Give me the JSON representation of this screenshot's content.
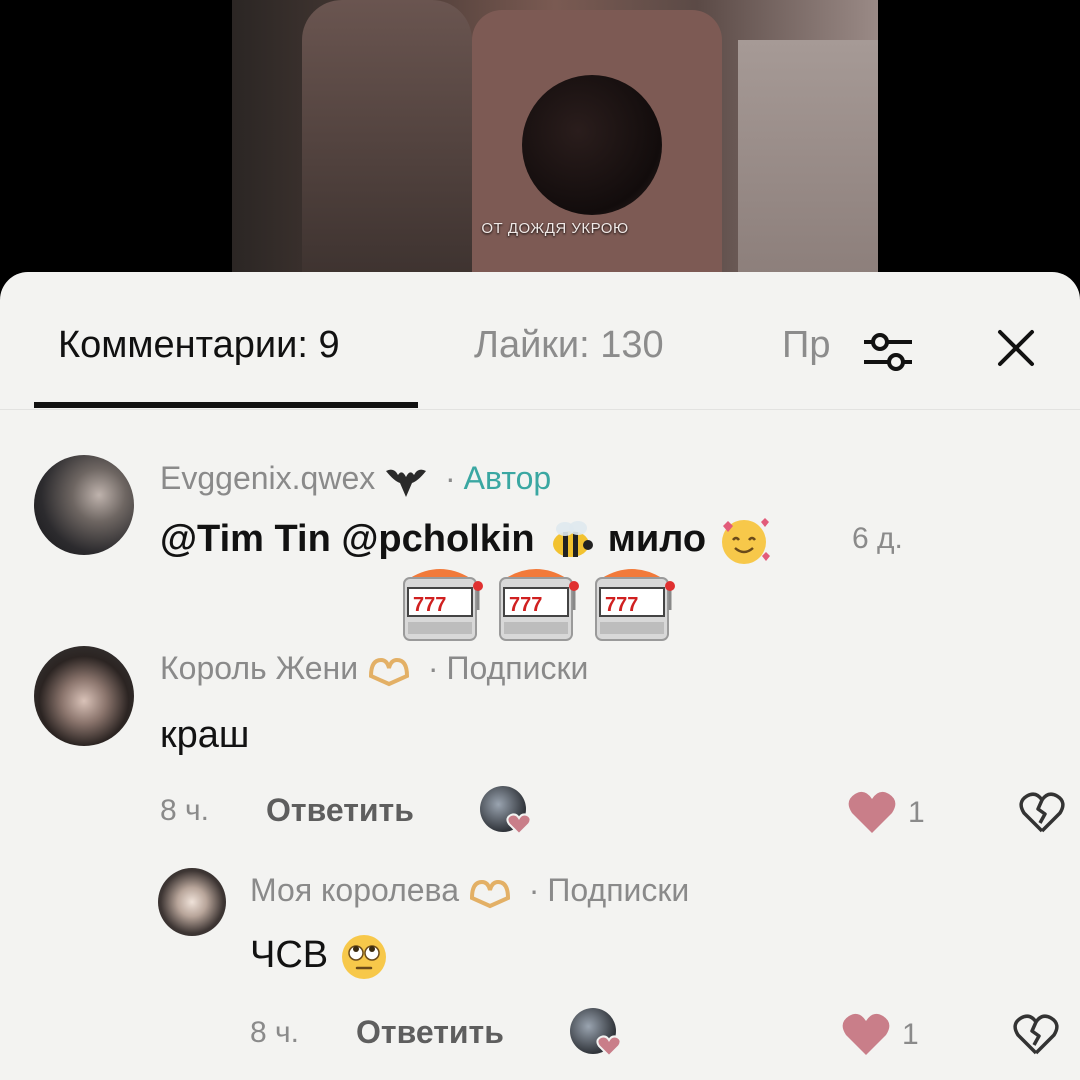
{
  "video": {
    "subtitle": "ОТ ДОЖДЯ УКРОЮ"
  },
  "tabs": {
    "comments": "Комментарии: 9",
    "likes": "Лайки: 130",
    "third_truncated": "Пр"
  },
  "icons": {
    "filter": "filter-sliders-icon",
    "close": "close-icon"
  },
  "comments": [
    {
      "username": "Evggenix.qwex",
      "badge": "Автор",
      "separator": "·",
      "text_mentions": "@Tim Tin @pcholkin",
      "text_word": "мило",
      "time": "6 д.",
      "emoji": [
        "bee",
        "smiling-face-with-hearts",
        "slot-machine",
        "slot-machine",
        "slot-machine"
      ]
    },
    {
      "username": "Король Жени",
      "badge": "Подписки",
      "separator": "·",
      "text": "краш",
      "time": "8 ч.",
      "reply": "Ответить",
      "likes": "1"
    },
    {
      "username": "Моя королева",
      "badge": "Подписки",
      "separator": "·",
      "text": "ЧСВ",
      "time": "8 ч.",
      "reply": "Ответить",
      "likes": "1"
    }
  ],
  "colors": {
    "like": "#c97e89",
    "author_badge": "#3aa7a2",
    "panel_bg": "#f3f3f1"
  }
}
